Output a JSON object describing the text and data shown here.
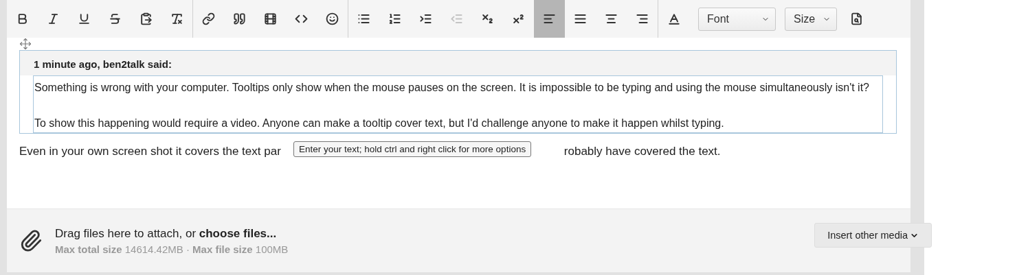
{
  "toolbar": {
    "groups": [
      [
        {
          "kind": "bold",
          "selected": false,
          "disabled": false
        },
        {
          "kind": "italic",
          "selected": false,
          "disabled": false
        },
        {
          "kind": "underline",
          "selected": false,
          "disabled": false
        },
        {
          "kind": "strike",
          "selected": false,
          "disabled": false
        },
        {
          "kind": "paste",
          "selected": false,
          "disabled": false
        },
        {
          "kind": "clear-format",
          "selected": false,
          "disabled": false
        }
      ],
      [
        {
          "kind": "link",
          "selected": false,
          "disabled": false
        },
        {
          "kind": "quote",
          "selected": false,
          "disabled": false
        },
        {
          "kind": "media",
          "selected": false,
          "disabled": false
        },
        {
          "kind": "code",
          "selected": false,
          "disabled": false
        },
        {
          "kind": "emoji",
          "selected": false,
          "disabled": false
        }
      ],
      [
        {
          "kind": "bullets",
          "selected": false,
          "disabled": false
        },
        {
          "kind": "numbers",
          "selected": false,
          "disabled": false
        },
        {
          "kind": "indent",
          "selected": false,
          "disabled": false
        },
        {
          "kind": "outdent",
          "selected": false,
          "disabled": true
        },
        {
          "kind": "subscript",
          "selected": false,
          "disabled": false
        },
        {
          "kind": "superscript",
          "selected": false,
          "disabled": false
        },
        {
          "kind": "align-left",
          "selected": true,
          "disabled": false
        },
        {
          "kind": "justify",
          "selected": false,
          "disabled": false
        },
        {
          "kind": "align-center",
          "selected": false,
          "disabled": false
        },
        {
          "kind": "align-right",
          "selected": false,
          "disabled": false
        }
      ]
    ],
    "font_dropdown": "Font",
    "size_dropdown": "Size"
  },
  "quote": {
    "header": "1 minute ago, ben2talk said:",
    "paragraphs": [
      "Something is wrong with your computer. Tooltips only show when the mouse pauses on the screen. It is impossible to be typing and using the mouse simultaneously isn't it?",
      "To show this happening would require a video. Anyone can make a tooltip cover text, but I'd challenge anyone to make it happen whilst typing."
    ]
  },
  "reply": {
    "before_tooltip": "Even in your own screen shot it covers the text par",
    "after_tooltip": "robably have covered the text."
  },
  "tooltip": "Enter your text; hold ctrl and right click for more options",
  "attach": {
    "prompt": "Drag files here to attach, or **choose files...**",
    "limits": "**Max total size** 14614.42MB · **Max file size** 100MB",
    "media_button": "Insert other media"
  }
}
